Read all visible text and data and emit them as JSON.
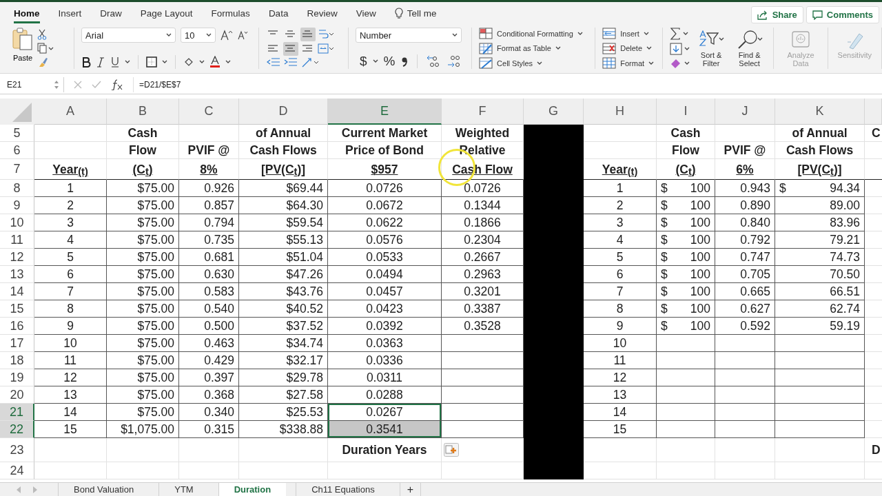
{
  "ribbon": {
    "tabs": [
      {
        "label": "Home",
        "selected": true
      },
      {
        "label": "Insert",
        "selected": false
      },
      {
        "label": "Draw",
        "selected": false
      },
      {
        "label": "Page Layout",
        "selected": false
      },
      {
        "label": "Formulas",
        "selected": false
      },
      {
        "label": "Data",
        "selected": false
      },
      {
        "label": "Review",
        "selected": false
      },
      {
        "label": "View",
        "selected": false
      }
    ],
    "tell_me": "Tell me",
    "share": "Share",
    "comments": "Comments",
    "paste": "Paste",
    "font": "Arial",
    "font_size": "10",
    "number_format": "Number",
    "currency": "$",
    "percent": "%",
    "styles": [
      "Conditional Formatting",
      "Format as Table",
      "Cell Styles"
    ],
    "cells": [
      "Insert",
      "Delete",
      "Format"
    ],
    "editing": [
      "Sort & Filter",
      "Find & Select"
    ],
    "tools": [
      {
        "label": "Analyze Data",
        "disabled": true
      },
      {
        "label": "Sensitivity",
        "disabled": true
      }
    ]
  },
  "formula_bar": {
    "name_box": "E21",
    "formula": "=D21/$E$7"
  },
  "columns": [
    {
      "letter": "A",
      "selected": false,
      "masked": false
    },
    {
      "letter": "B",
      "selected": false,
      "masked": false
    },
    {
      "letter": "C",
      "selected": false,
      "masked": false
    },
    {
      "letter": "D",
      "selected": false,
      "masked": false
    },
    {
      "letter": "E",
      "selected": true,
      "masked": false
    },
    {
      "letter": "F",
      "selected": false,
      "masked": false
    },
    {
      "letter": "G",
      "selected": false,
      "masked": true
    },
    {
      "letter": "H",
      "selected": false,
      "masked": false
    },
    {
      "letter": "I",
      "selected": false,
      "masked": false
    },
    {
      "letter": "J",
      "selected": false,
      "masked": false
    },
    {
      "letter": "K",
      "selected": false,
      "masked": false
    }
  ],
  "rows": [
    {
      "number": "5",
      "kind": "header",
      "selected": false,
      "cells": [
        null,
        {
          "kind": "center",
          "text": "Cash"
        },
        null,
        {
          "kind": "center",
          "text": "of Annual"
        },
        {
          "kind": "center",
          "text": "Current Market"
        },
        {
          "kind": "center",
          "text": "Weighted"
        },
        null,
        null,
        {
          "kind": "center",
          "text": "Cash"
        },
        null,
        {
          "kind": "center",
          "text": "of Annual"
        },
        {
          "kind": "left",
          "text": "C"
        }
      ]
    },
    {
      "number": "6",
      "kind": "header",
      "selected": false,
      "cells": [
        null,
        {
          "kind": "center",
          "text": "Flow"
        },
        {
          "kind": "center",
          "text": "PVIF @"
        },
        {
          "kind": "center",
          "text": "Cash Flows"
        },
        {
          "kind": "center",
          "text": "Price of Bond"
        },
        {
          "kind": "center",
          "text": "Relative"
        },
        null,
        null,
        {
          "kind": "center",
          "text": "Flow"
        },
        {
          "kind": "center",
          "text": "PVIF @"
        },
        {
          "kind": "center",
          "text": "Cash Flows"
        }
      ]
    },
    {
      "number": "7",
      "kind": "underlined",
      "selected": false,
      "cells": [
        {
          "kind": "center",
          "text": "Year$_{(t)}$"
        },
        {
          "kind": "center",
          "text": "(C$_{t}$)"
        },
        {
          "kind": "center",
          "text": "8%"
        },
        {
          "kind": "center",
          "text": "[PV(C$_{t}$)]"
        },
        {
          "kind": "center",
          "text": "$957"
        },
        {
          "kind": "center",
          "text": "Cash Flow"
        },
        null,
        {
          "kind": "center",
          "text": "Year$_{(t)}$"
        },
        {
          "kind": "center",
          "text": "(C$_{t}$)"
        },
        {
          "kind": "center",
          "text": "6%"
        },
        {
          "kind": "center",
          "text": "[PV(C$_{t}$)]"
        }
      ]
    },
    {
      "number": "8",
      "kind": "data",
      "selected": false,
      "cells": [
        {
          "kind": "center",
          "text": "1"
        },
        {
          "kind": "right",
          "text": "$75.00"
        },
        {
          "kind": "right",
          "text": "0.926"
        },
        {
          "kind": "right",
          "text": "$69.44"
        },
        {
          "kind": "center",
          "text": "0.0726"
        },
        {
          "kind": "center",
          "text": "0.0726"
        },
        null,
        {
          "kind": "center",
          "text": "1"
        },
        {
          "kind": "accounting",
          "symbol": "$",
          "text": "100"
        },
        {
          "kind": "right",
          "text": "0.943"
        },
        {
          "kind": "accounting",
          "symbol": "$",
          "text": "94.34"
        }
      ]
    },
    {
      "number": "9",
      "kind": "data",
      "selected": false,
      "cells": [
        {
          "kind": "center",
          "text": "2"
        },
        {
          "kind": "right",
          "text": "$75.00"
        },
        {
          "kind": "right",
          "text": "0.857"
        },
        {
          "kind": "right",
          "text": "$64.30"
        },
        {
          "kind": "center",
          "text": "0.0672"
        },
        {
          "kind": "center",
          "text": "0.1344"
        },
        null,
        {
          "kind": "center",
          "text": "2"
        },
        {
          "kind": "accounting",
          "symbol": "$",
          "text": "100"
        },
        {
          "kind": "right",
          "text": "0.890"
        },
        {
          "kind": "right",
          "text": "89.00"
        }
      ]
    },
    {
      "number": "10",
      "kind": "data",
      "selected": false,
      "cells": [
        {
          "kind": "center",
          "text": "3"
        },
        {
          "kind": "right",
          "text": "$75.00"
        },
        {
          "kind": "right",
          "text": "0.794"
        },
        {
          "kind": "right",
          "text": "$59.54"
        },
        {
          "kind": "center",
          "text": "0.0622"
        },
        {
          "kind": "center",
          "text": "0.1866"
        },
        null,
        {
          "kind": "center",
          "text": "3"
        },
        {
          "kind": "accounting",
          "symbol": "$",
          "text": "100"
        },
        {
          "kind": "right",
          "text": "0.840"
        },
        {
          "kind": "right",
          "text": "83.96"
        }
      ]
    },
    {
      "number": "11",
      "kind": "data",
      "selected": false,
      "cells": [
        {
          "kind": "center",
          "text": "4"
        },
        {
          "kind": "right",
          "text": "$75.00"
        },
        {
          "kind": "right",
          "text": "0.735"
        },
        {
          "kind": "right",
          "text": "$55.13"
        },
        {
          "kind": "center",
          "text": "0.0576"
        },
        {
          "kind": "center",
          "text": "0.2304"
        },
        null,
        {
          "kind": "center",
          "text": "4"
        },
        {
          "kind": "accounting",
          "symbol": "$",
          "text": "100"
        },
        {
          "kind": "right",
          "text": "0.792"
        },
        {
          "kind": "right",
          "text": "79.21"
        }
      ]
    },
    {
      "number": "12",
      "kind": "data",
      "selected": false,
      "cells": [
        {
          "kind": "center",
          "text": "5"
        },
        {
          "kind": "right",
          "text": "$75.00"
        },
        {
          "kind": "right",
          "text": "0.681"
        },
        {
          "kind": "right",
          "text": "$51.04"
        },
        {
          "kind": "center",
          "text": "0.0533"
        },
        {
          "kind": "center",
          "text": "0.2667"
        },
        null,
        {
          "kind": "center",
          "text": "5"
        },
        {
          "kind": "accounting",
          "symbol": "$",
          "text": "100"
        },
        {
          "kind": "right",
          "text": "0.747"
        },
        {
          "kind": "right",
          "text": "74.73"
        }
      ]
    },
    {
      "number": "13",
      "kind": "data",
      "selected": false,
      "cells": [
        {
          "kind": "center",
          "text": "6"
        },
        {
          "kind": "right",
          "text": "$75.00"
        },
        {
          "kind": "right",
          "text": "0.630"
        },
        {
          "kind": "right",
          "text": "$47.26"
        },
        {
          "kind": "center",
          "text": "0.0494"
        },
        {
          "kind": "center",
          "text": "0.2963"
        },
        null,
        {
          "kind": "center",
          "text": "6"
        },
        {
          "kind": "accounting",
          "symbol": "$",
          "text": "100"
        },
        {
          "kind": "right",
          "text": "0.705"
        },
        {
          "kind": "right",
          "text": "70.50"
        }
      ]
    },
    {
      "number": "14",
      "kind": "data",
      "selected": false,
      "cells": [
        {
          "kind": "center",
          "text": "7"
        },
        {
          "kind": "right",
          "text": "$75.00"
        },
        {
          "kind": "right",
          "text": "0.583"
        },
        {
          "kind": "right",
          "text": "$43.76"
        },
        {
          "kind": "center",
          "text": "0.0457"
        },
        {
          "kind": "center",
          "text": "0.3201"
        },
        null,
        {
          "kind": "center",
          "text": "7"
        },
        {
          "kind": "accounting",
          "symbol": "$",
          "text": "100"
        },
        {
          "kind": "right",
          "text": "0.665"
        },
        {
          "kind": "right",
          "text": "66.51"
        }
      ]
    },
    {
      "number": "15",
      "kind": "data",
      "selected": false,
      "cells": [
        {
          "kind": "center",
          "text": "8"
        },
        {
          "kind": "right",
          "text": "$75.00"
        },
        {
          "kind": "right",
          "text": "0.540"
        },
        {
          "kind": "right",
          "text": "$40.52"
        },
        {
          "kind": "center",
          "text": "0.0423"
        },
        {
          "kind": "center",
          "text": "0.3387"
        },
        null,
        {
          "kind": "center",
          "text": "8"
        },
        {
          "kind": "accounting",
          "symbol": "$",
          "text": "100"
        },
        {
          "kind": "right",
          "text": "0.627"
        },
        {
          "kind": "right",
          "text": "62.74"
        }
      ]
    },
    {
      "number": "16",
      "kind": "data",
      "selected": false,
      "cells": [
        {
          "kind": "center",
          "text": "9"
        },
        {
          "kind": "right",
          "text": "$75.00"
        },
        {
          "kind": "right",
          "text": "0.500"
        },
        {
          "kind": "right",
          "text": "$37.52"
        },
        {
          "kind": "center",
          "text": "0.0392"
        },
        {
          "kind": "center",
          "text": "0.3528"
        },
        null,
        {
          "kind": "center",
          "text": "9"
        },
        {
          "kind": "accounting",
          "symbol": "$",
          "text": "100"
        },
        {
          "kind": "right",
          "text": "0.592"
        },
        {
          "kind": "right",
          "text": "59.19"
        }
      ]
    },
    {
      "number": "17",
      "kind": "data",
      "selected": false,
      "cells": [
        {
          "kind": "center",
          "text": "10"
        },
        {
          "kind": "right",
          "text": "$75.00"
        },
        {
          "kind": "right",
          "text": "0.463"
        },
        {
          "kind": "right",
          "text": "$34.74"
        },
        {
          "kind": "center",
          "text": "0.0363"
        },
        null,
        null,
        {
          "kind": "center",
          "text": "10"
        }
      ]
    },
    {
      "number": "18",
      "kind": "data",
      "selected": false,
      "cells": [
        {
          "kind": "center",
          "text": "11"
        },
        {
          "kind": "right",
          "text": "$75.00"
        },
        {
          "kind": "right",
          "text": "0.429"
        },
        {
          "kind": "right",
          "text": "$32.17"
        },
        {
          "kind": "center",
          "text": "0.0336"
        },
        null,
        null,
        {
          "kind": "center",
          "text": "11"
        }
      ]
    },
    {
      "number": "19",
      "kind": "data",
      "selected": false,
      "cells": [
        {
          "kind": "center",
          "text": "12"
        },
        {
          "kind": "right",
          "text": "$75.00"
        },
        {
          "kind": "right",
          "text": "0.397"
        },
        {
          "kind": "right",
          "text": "$29.78"
        },
        {
          "kind": "center",
          "text": "0.0311"
        },
        null,
        null,
        {
          "kind": "center",
          "text": "12"
        }
      ]
    },
    {
      "number": "20",
      "kind": "data",
      "selected": false,
      "cells": [
        {
          "kind": "center",
          "text": "13"
        },
        {
          "kind": "right",
          "text": "$75.00"
        },
        {
          "kind": "right",
          "text": "0.368"
        },
        {
          "kind": "right",
          "text": "$27.58"
        },
        {
          "kind": "center",
          "text": "0.0288"
        },
        null,
        null,
        {
          "kind": "center",
          "text": "13"
        }
      ]
    },
    {
      "number": "21",
      "kind": "data",
      "selected": true,
      "cells": [
        {
          "kind": "center",
          "text": "14"
        },
        {
          "kind": "right",
          "text": "$75.00"
        },
        {
          "kind": "right",
          "text": "0.340"
        },
        {
          "kind": "right",
          "text": "$25.53"
        },
        {
          "kind": "center",
          "text": "0.0267"
        },
        null,
        null,
        {
          "kind": "center",
          "text": "14"
        }
      ]
    },
    {
      "number": "22",
      "kind": "data",
      "selected": true,
      "cells": [
        {
          "kind": "center",
          "text": "15"
        },
        {
          "kind": "right",
          "text": "$1,075.00"
        },
        {
          "kind": "right",
          "text": "0.315"
        },
        {
          "kind": "right",
          "text": "$338.88"
        },
        {
          "kind": "center",
          "text": "0.3541"
        },
        null,
        null,
        {
          "kind": "center",
          "text": "15"
        }
      ]
    },
    {
      "number": "23",
      "kind": "header",
      "selected": false,
      "cells": [
        null,
        null,
        null,
        null,
        {
          "kind": "center",
          "text": "Duration Years"
        },
        null,
        null,
        null,
        null,
        null,
        null,
        {
          "kind": "left",
          "text": "D"
        }
      ]
    },
    {
      "number": "24",
      "kind": "blank",
      "selected": false
    }
  ],
  "sheet_tabs": [
    {
      "label": "Bond Valuation",
      "selected": false
    },
    {
      "label": "YTM",
      "selected": false
    },
    {
      "label": "Duration",
      "selected": true
    },
    {
      "label": "Ch11 Equations",
      "selected": false
    }
  ],
  "add_sheet": "+"
}
